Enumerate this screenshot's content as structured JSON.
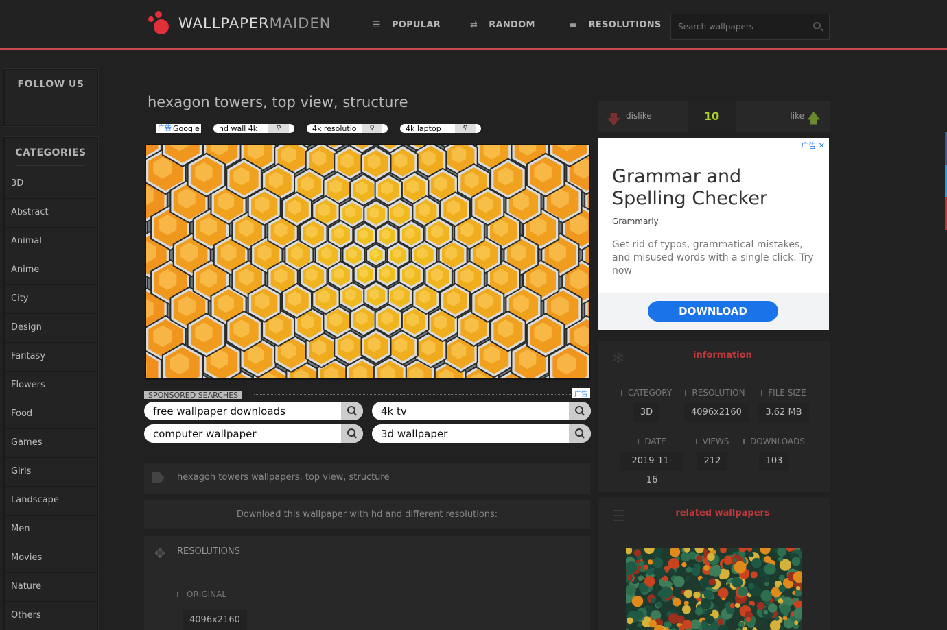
{
  "header": {
    "logo_part1": "WALLPAPER",
    "logo_part2": "MAIDEN",
    "nav": [
      {
        "label": "POPULAR",
        "icon": "list-icon"
      },
      {
        "label": "RANDOM",
        "icon": "shuffle-icon"
      },
      {
        "label": "RESOLUTIONS",
        "icon": "folder-icon"
      }
    ],
    "search_placeholder": "Search wallpapers"
  },
  "sidebar": {
    "follow_title": "FOLLOW US",
    "categories_title": "CATEGORIES",
    "categories": [
      "3D",
      "Abstract",
      "Animal",
      "Anime",
      "City",
      "Design",
      "Fantasy",
      "Flowers",
      "Food",
      "Games",
      "Girls",
      "Landscape",
      "Men",
      "Movies",
      "Nature",
      "Others"
    ]
  },
  "main": {
    "title": "hexagon towers, top view, structure",
    "ad_chips": {
      "ad_label": "广告",
      "google": "Google",
      "items": [
        "hd wall 4k",
        "4k resolutio",
        "4k laptop"
      ]
    },
    "sponsored": {
      "label": "SPONSORED SEARCHES",
      "ad_mark": "广告",
      "searches": [
        "free wallpaper downloads",
        "4k tv",
        "computer wallpaper",
        "3d wallpaper"
      ]
    },
    "tags_text": "hexagon towers wallpapers, top view, structure",
    "download_text": "Download this wallpaper with hd and different resolutions:",
    "resolutions": {
      "title": "RESOLUTIONS",
      "original_label": "ORIGINAL",
      "original_value": "4096x2160"
    }
  },
  "right": {
    "vote": {
      "dislike": "dislike",
      "count": "10",
      "like": "like"
    },
    "ad": {
      "ad_mark": "广告",
      "headline": "Grammar and Spelling Checker",
      "brand": "Grammarly",
      "description": "Get rid of typos, grammatical mistakes, and misused words with a single click. Try now",
      "cta": "DOWNLOAD"
    },
    "information": {
      "title": "information",
      "category_label": "CATEGORY",
      "category": "3D",
      "resolution_label": "RESOLUTION",
      "resolution": "4096x2160",
      "filesize_label": "FILE SIZE",
      "filesize": "3.62 MB",
      "date_label": "DATE",
      "date": "2019-11-16",
      "views_label": "VIEWS",
      "views": "212",
      "downloads_label": "DOWNLOADS",
      "downloads": "103"
    },
    "related_title": "related wallpapers"
  },
  "colors": {
    "accent": "#c94a4a",
    "like_count": "#a8d12a",
    "ad_blue": "#1a73e8",
    "hex_orange": "#f28a1e"
  }
}
